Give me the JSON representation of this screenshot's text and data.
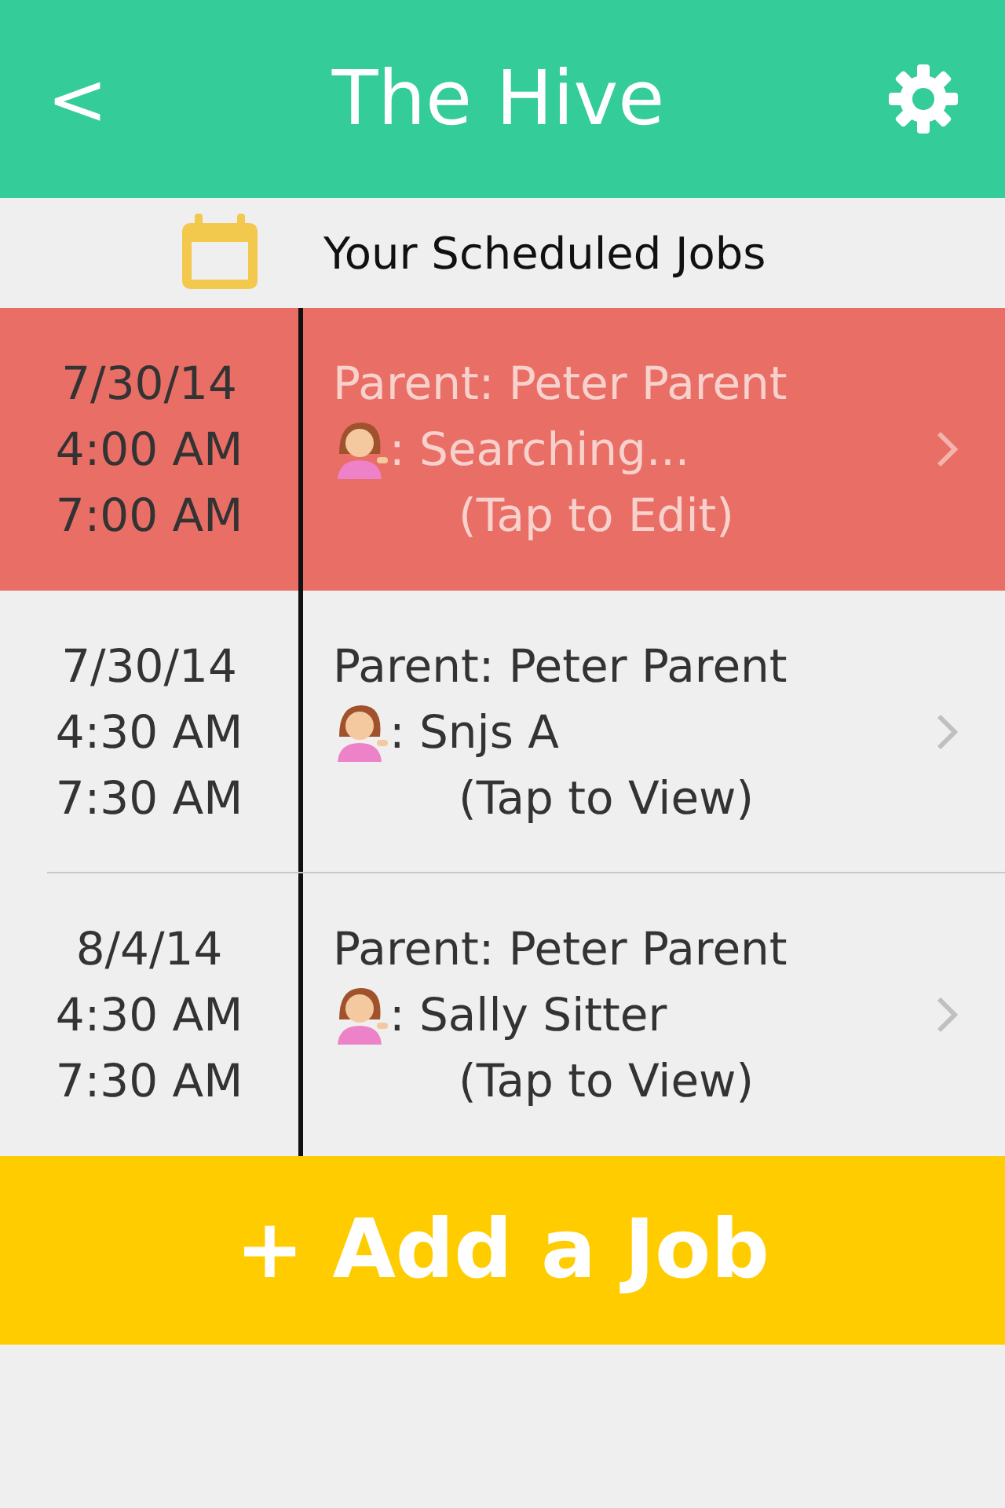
{
  "header": {
    "back": "<",
    "title": "The Hive"
  },
  "section_title": "Your Scheduled Jobs",
  "jobs": [
    {
      "date": "7/30/14",
      "start": "4:00 AM",
      "end": "7:00 AM",
      "parent": "Parent: Peter Parent",
      "sitter": ": Searching...",
      "action": "(Tap to Edit)",
      "selected": true
    },
    {
      "date": "7/30/14",
      "start": "4:30 AM",
      "end": "7:30 AM",
      "parent": "Parent: Peter Parent",
      "sitter": ": Snjs A",
      "action": "(Tap to View)",
      "selected": false
    },
    {
      "date": "8/4/14",
      "start": "4:30 AM",
      "end": "7:30 AM",
      "parent": "Parent: Peter Parent",
      "sitter": ": Sally Sitter",
      "action": "(Tap to View)",
      "selected": false
    }
  ],
  "add_button": "+ Add a Job"
}
